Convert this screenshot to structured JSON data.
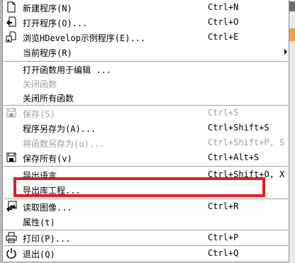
{
  "menu": {
    "items": [
      {
        "label": "新建程序(N)",
        "accel": "Ctrl+N",
        "icon": "new-file-icon",
        "enabled": true
      },
      {
        "label": "打开程序(O)...",
        "accel": "Ctrl+O",
        "icon": "open-program-icon",
        "enabled": true
      },
      {
        "label": "浏览HDevelop示例程序(E)...",
        "accel": "Ctrl+E",
        "icon": "browse-examples-icon",
        "enabled": true
      },
      {
        "label": "当前程序(R)",
        "accel": "",
        "icon": "",
        "enabled": true,
        "submenu": true
      },
      {
        "label": "打开函数用于编辑 ...",
        "accel": "",
        "icon": "",
        "enabled": true
      },
      {
        "label": "关闭函数",
        "accel": "",
        "icon": "",
        "enabled": false
      },
      {
        "label": "关闭所有函数",
        "accel": "",
        "icon": "",
        "enabled": true
      },
      {
        "label": "保存(S)",
        "accel": "Ctrl+S",
        "icon": "save-icon",
        "enabled": false
      },
      {
        "label": "程序另存为(A)...",
        "accel": "Ctrl+Shift+S",
        "icon": "",
        "enabled": true
      },
      {
        "label": "将函数另存为(u)...",
        "accel": "Ctrl+Shift+P, S",
        "icon": "",
        "enabled": false
      },
      {
        "label": "保存所有(v)",
        "accel": "Ctrl+Alt+S",
        "icon": "save-all-icon",
        "enabled": true
      },
      {
        "label": "导出语言...",
        "accel": "Ctrl+Shift+O, X",
        "icon": "",
        "enabled": true
      },
      {
        "label": "导出库工程...",
        "accel": "",
        "icon": "",
        "enabled": true
      },
      {
        "label": "读取图像...",
        "accel": "Ctrl+R",
        "icon": "read-image-icon",
        "enabled": true
      },
      {
        "label": "属性(t)",
        "accel": "",
        "icon": "",
        "enabled": true
      },
      {
        "label": "打印(P)...",
        "accel": "Ctrl+P",
        "icon": "print-icon",
        "enabled": true
      },
      {
        "label": "退出(Q)",
        "accel": "Ctrl+Q",
        "icon": "power-icon",
        "enabled": true
      }
    ]
  },
  "colors": {
    "highlight_border": "#e01f26",
    "disabled_text": "#a0a0a0"
  }
}
